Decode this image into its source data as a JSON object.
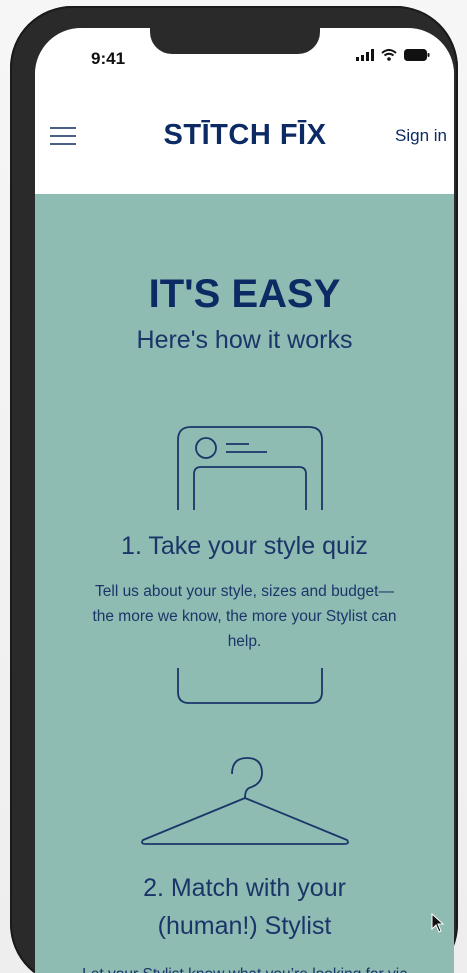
{
  "status_bar": {
    "time": "9:41",
    "icons": [
      "signal-icon",
      "wifi-icon",
      "battery-icon"
    ]
  },
  "header": {
    "menu_icon": "hamburger-menu-icon",
    "logo_text": "STĪTCH FĪX",
    "signin_label": "Sign in"
  },
  "main": {
    "heading": "IT'S EASY",
    "subheading": "Here's how it works",
    "steps": [
      {
        "icon": "phone-outline-icon",
        "title": "1. Take your style quiz",
        "description": "Tell us about your style, sizes and budget—the more we know, the more your Stylist can help."
      },
      {
        "icon": "hanger-icon",
        "title_line1": "2. Match with your",
        "title_line2": "(human!) Stylist",
        "description": "Let your Stylist know what you’re looking for via"
      }
    ]
  },
  "colors": {
    "section_bg": "#8ebcb2",
    "navy": "#0c2a63",
    "header_bg": "#ffffff",
    "phone_frame": "#2a2a2a"
  }
}
